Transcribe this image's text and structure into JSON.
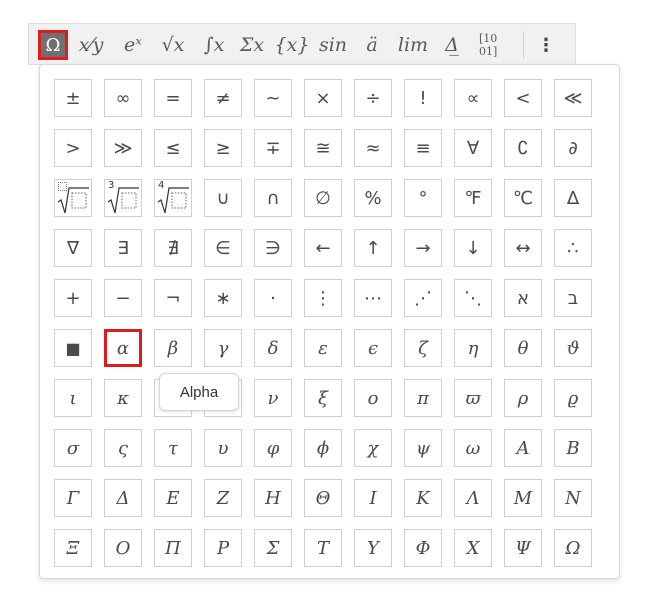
{
  "toolbar": {
    "buttons": [
      {
        "name": "special-characters-button",
        "label": "Ω"
      },
      {
        "name": "fraction-button",
        "label": "x⁄y"
      },
      {
        "name": "exponent-button",
        "label": "eˣ"
      },
      {
        "name": "square-root-button",
        "label": "√x"
      },
      {
        "name": "integral-button",
        "label": "∫x"
      },
      {
        "name": "summation-button",
        "label": "Σx"
      },
      {
        "name": "braces-button",
        "label": "{x}"
      },
      {
        "name": "trig-button",
        "label": "sin"
      },
      {
        "name": "accent-button",
        "label": "ä"
      },
      {
        "name": "limit-button",
        "label": "lim"
      },
      {
        "name": "decoration-button",
        "label": "Δ̲"
      },
      {
        "name": "matrix-button",
        "label": "[10 01]"
      }
    ],
    "more_label": "⋮"
  },
  "symbols": [
    "±",
    "∞",
    "=",
    "≠",
    "~",
    "×",
    "÷",
    "!",
    "∝",
    "<",
    "≪",
    ">",
    "≫",
    "≤",
    "≥",
    "∓",
    "≅",
    "≈",
    "≡",
    "∀",
    "∁",
    "∂",
    "√",
    "∛",
    "∜",
    "∪",
    "∩",
    "∅",
    "%",
    "°",
    "℉",
    "℃",
    "∆",
    "∇",
    "∃",
    "∄",
    "∈",
    "∋",
    "←",
    "↑",
    "→",
    "↓",
    "↔",
    "∴",
    "+",
    "−",
    "¬",
    "∗",
    "·",
    "⋮",
    "⋯",
    "⋰",
    "⋱",
    "א",
    "ב",
    "■",
    "α",
    "β",
    "γ",
    "δ",
    "ε",
    "ϵ",
    "ζ",
    "η",
    "θ",
    "ϑ",
    "ι",
    "κ",
    "λ",
    "μ",
    "ν",
    "ξ",
    "ο",
    "π",
    "ϖ",
    "ρ",
    "ϱ",
    "σ",
    "ς",
    "τ",
    "υ",
    "φ",
    "ϕ",
    "χ",
    "ψ",
    "ω",
    "Α",
    "Β",
    "Γ",
    "Δ",
    "Ε",
    "Ζ",
    "Η",
    "Θ",
    "Ι",
    "Κ",
    "Λ",
    "Μ",
    "Ν",
    "Ξ",
    "Ο",
    "Π",
    "Ρ",
    "Σ",
    "Τ",
    "Υ",
    "Φ",
    "Χ",
    "Ψ",
    "Ω"
  ],
  "selected_symbol": "α",
  "tooltip": "Alpha",
  "colors": {
    "highlight": "#e01b1b"
  }
}
